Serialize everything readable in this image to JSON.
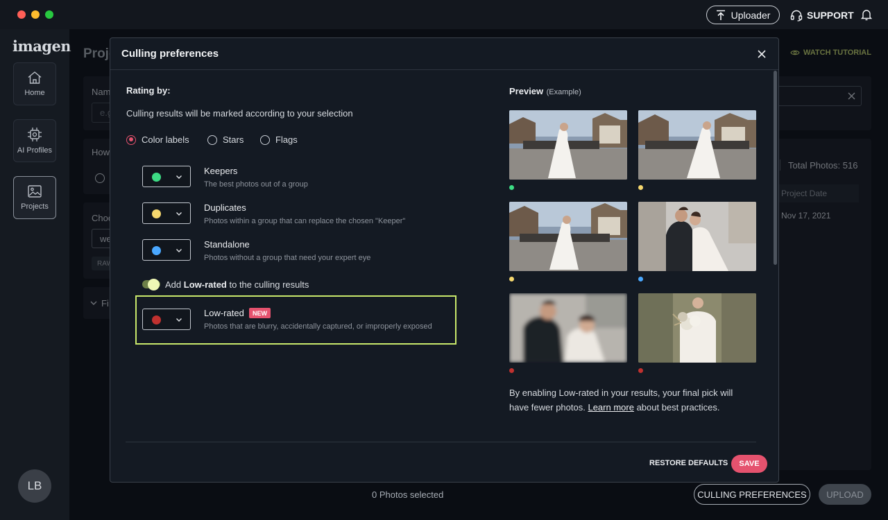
{
  "window": {
    "uploader_label": "Uploader",
    "support_label": "SUPPORT"
  },
  "sidebar": {
    "logo": "imagen",
    "items": [
      {
        "label": "Home",
        "icon": "home-icon"
      },
      {
        "label": "AI Profiles",
        "icon": "ai-chip-icon"
      },
      {
        "label": "Projects",
        "icon": "image-icon"
      }
    ],
    "avatar_initials": "LB"
  },
  "background": {
    "page_title": "Proje",
    "watch_tutorial": "WATCH TUTORIAL",
    "name_label": "Nam",
    "name_placeholder": "e.g",
    "how_label": "How",
    "choose_label": "Choo",
    "choose_value": "we",
    "raw_tag": "RAW",
    "filters_label": "Fi",
    "total_photos": "Total Photos: 516",
    "table_header": "Project Date",
    "table_row_date": "Nov 17, 2021",
    "photos_selected": "0 Photos selected",
    "culling_prefs_button": "CULLING PREFERENCES",
    "upload_button": "UPLOAD"
  },
  "modal": {
    "title": "Culling preferences",
    "rating_by_label": "Rating by:",
    "rating_desc": "Culling results will be marked according to your selection",
    "rating_options": [
      {
        "label": "Color labels",
        "selected": true
      },
      {
        "label": "Stars",
        "selected": false
      },
      {
        "label": "Flags",
        "selected": false
      }
    ],
    "labels": [
      {
        "title": "Keepers",
        "desc": "The best photos out of a group",
        "color": "#3ddc84"
      },
      {
        "title": "Duplicates",
        "desc": "Photos within a group that can replace the chosen \"Keeper\"",
        "color": "#f5d76e"
      },
      {
        "title": "Standalone",
        "desc": "Photos without a group that need your expert eye",
        "color": "#4aa8ff"
      }
    ],
    "lowrated_toggle": {
      "prefix": "Add ",
      "bold": "Low-rated",
      "suffix": " to the culling results",
      "enabled": true
    },
    "lowrated": {
      "title": "Low-rated",
      "badge": "NEW",
      "desc": "Photos that are blurry, accidentally captured, or improperly exposed",
      "color": "#c0312f"
    },
    "preview": {
      "title": "Preview",
      "subtitle": "(Example)",
      "photo_dots": [
        "#3ddc84",
        "#f5d76e",
        "#f5d76e",
        "#4aa8ff",
        "#c0312f",
        "#c0312f"
      ]
    },
    "note": {
      "before": "By enabling Low-rated in your results, your final pick will have fewer photos. ",
      "link": "Learn more",
      "after": " about best practices."
    },
    "restore_label": "RESTORE DEFAULTS",
    "save_label": "SAVE"
  }
}
